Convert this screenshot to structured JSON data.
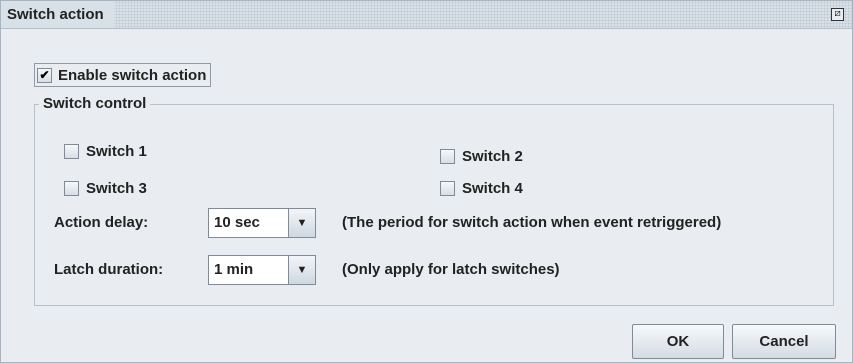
{
  "window": {
    "title": "Switch action"
  },
  "enable": {
    "label": "Enable switch action",
    "checked": true,
    "mark": "✔"
  },
  "group": {
    "legend": "Switch control",
    "switches": [
      {
        "label": "Switch 1",
        "checked": false
      },
      {
        "label": "Switch 2",
        "checked": false
      },
      {
        "label": "Switch 3",
        "checked": false
      },
      {
        "label": "Switch 4",
        "checked": false
      }
    ],
    "action_delay": {
      "label": "Action delay:",
      "value": "10 sec",
      "note": "(The period for switch action when event retriggered)"
    },
    "latch_duration": {
      "label": "Latch duration:",
      "value": "1 min",
      "note": "(Only apply for latch switches)"
    }
  },
  "buttons": {
    "ok": "OK",
    "cancel": "Cancel"
  }
}
